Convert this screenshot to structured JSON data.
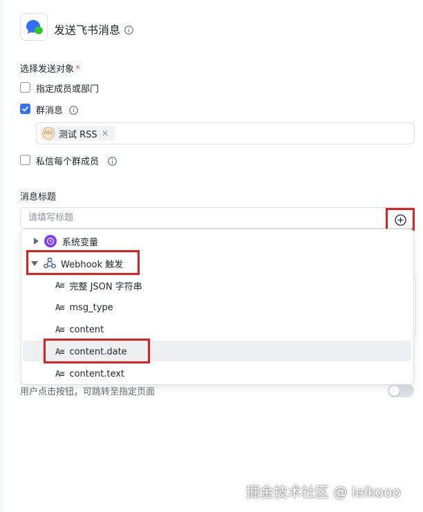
{
  "header": {
    "title": "发送飞书消息"
  },
  "recipients": {
    "label": "选择发送对象",
    "required_mark": "*",
    "options": [
      {
        "label": "指定成员或部门",
        "checked": false
      },
      {
        "label": "群消息",
        "checked": true
      },
      {
        "label": "私信每个群成员",
        "checked": false
      }
    ],
    "group_tag": {
      "avatar_text": "RSS",
      "label": "测试 RSS",
      "remove": "×"
    }
  },
  "message_title": {
    "label": "消息标题",
    "placeholder": "请填写标题",
    "value": ""
  },
  "variable_menu": {
    "system_vars": "系统变量",
    "webhook": {
      "label": "Webhook 触发",
      "items": [
        "完整 JSON 字符串",
        "msg_type",
        "content",
        "content.date",
        "content.text"
      ]
    },
    "selected": "content.date"
  },
  "background": {
    "hint": "用户点击按钮，可跳转至指定页面",
    "toggle_on": false
  },
  "watermark": "掘金技术社区 @ leikooo",
  "colors": {
    "accent": "#3370ff",
    "annotation": "#e02020",
    "system_icon": "#7f3bf5"
  }
}
